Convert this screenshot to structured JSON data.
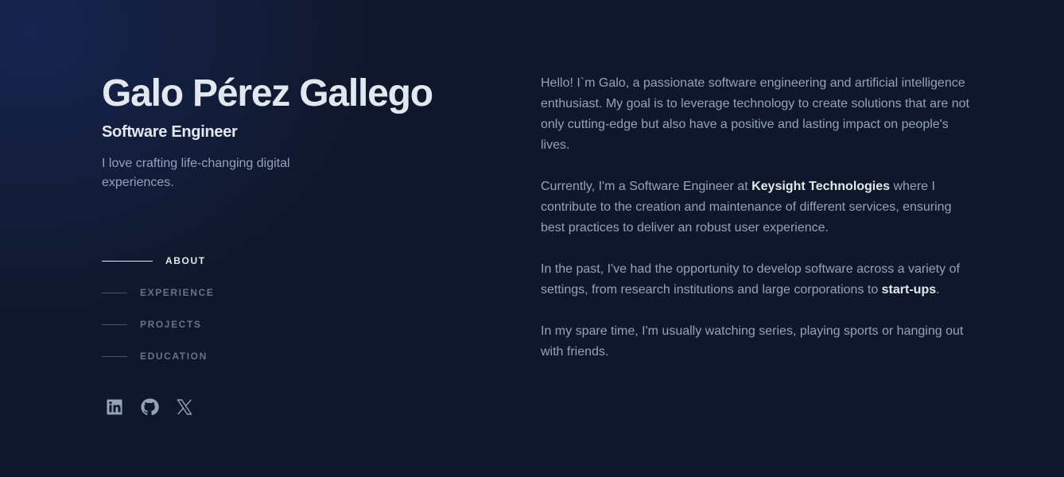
{
  "header": {
    "name": "Galo Pérez Gallego",
    "role": "Software Engineer",
    "tagline": "I love crafting life-changing digital experiences."
  },
  "nav": {
    "items": [
      {
        "label": "ABOUT",
        "active": true
      },
      {
        "label": "EXPERIENCE",
        "active": false
      },
      {
        "label": "PROJECTS",
        "active": false
      },
      {
        "label": "EDUCATION",
        "active": false
      }
    ]
  },
  "socials": [
    "linkedin-icon",
    "github-icon",
    "x-icon"
  ],
  "about": {
    "p1": "Hello! I`m Galo, a passionate software engineering and artificial intelligence enthusiast. My goal is to leverage technology to create solutions that are not only cutting-edge but also have a positive and lasting impact on people's lives.",
    "p2_before": "Currently, I'm a Software Engineer at ",
    "p2_highlight": "Keysight Technologies",
    "p2_after": " where I contribute to the creation and maintenance of different services, ensuring best practices to deliver an robust user experience.",
    "p3_before": "In the past, I've had the opportunity to develop software across a variety of settings, from research institutions and large corporations to ",
    "p3_highlight": "start-ups",
    "p3_after": ".",
    "p4": "In my spare time, I'm usually watching series, playing sports or hanging out with friends."
  },
  "colors": {
    "background": "#0f172a",
    "heading": "#e2e8f0",
    "body_text": "#94a3b8",
    "muted": "#64748b"
  }
}
